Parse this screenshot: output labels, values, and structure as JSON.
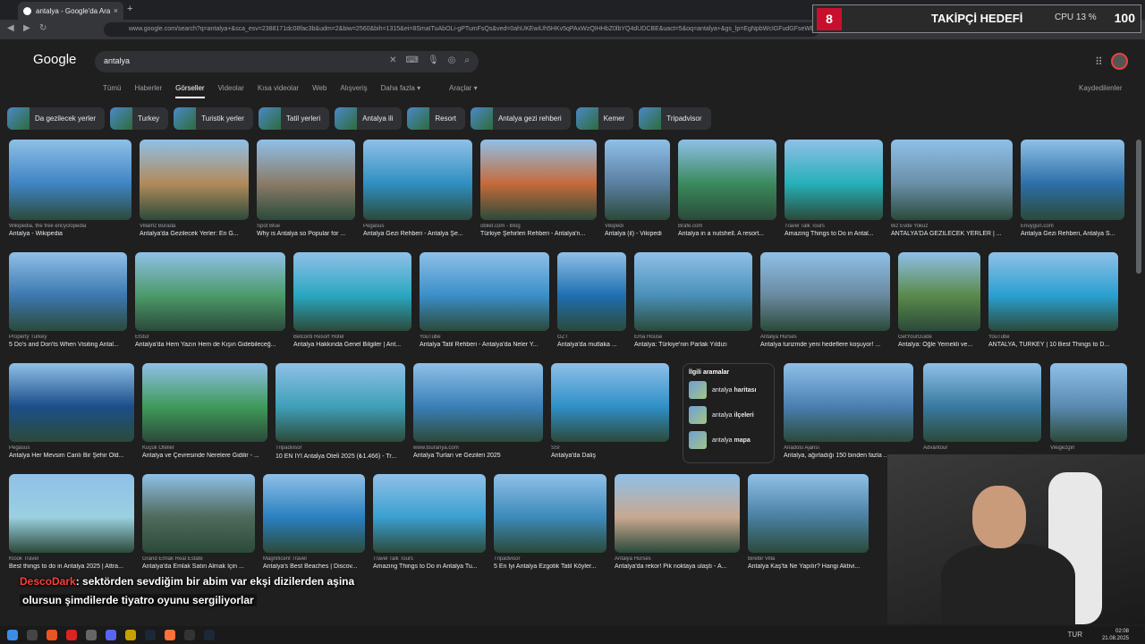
{
  "browser": {
    "tab_title": "antalya - Google'da Ara",
    "tab_close": "×",
    "new_tab": "+",
    "url": "www.google.com/search?q=antalya+&sca_esv=2388171dc08fac3b&udm=2&biw=2560&bih=1315&ei=8SmaITuAbOLi-gPTumFsQs&ved=0ahUKEwiUh5HKv5qPAxWzQIHHbZ0lbYQ4dUDCBE&uact=5&oq=antalya+&gs_lp=EgNpbWcIGFudGFseWEg"
  },
  "overlay": {
    "badge": "8",
    "text": "TAKİPÇİ HEDEFİ",
    "cpu": "CPU 13 %",
    "count": "100"
  },
  "google": {
    "logo": "Google",
    "query": "antalya",
    "tabs": [
      "Tümü",
      "Haberler",
      "Görseller",
      "Videolar",
      "Kısa videolar",
      "Web",
      "Alışveriş",
      "Daha fazla ▾"
    ],
    "active_tab": "Görseller",
    "tools": "Araçlar ▾",
    "saved": "Kaydedilenler"
  },
  "chips": [
    "Da gezilecek yerler",
    "Turkey",
    "Turistik yerler",
    "Tatil yerleri",
    "Antalya ili",
    "Resort",
    "Antalya gezi rehberi",
    "Kemer",
    "Tripadvisor"
  ],
  "rows": [
    [
      {
        "src": "Wikipedia, the free encyclopedia",
        "cap": "Antalya - Wikipedia",
        "color": "#3f84c4"
      },
      {
        "src": "Villamz Burada",
        "cap": "Antalya'da Gezilecek Yerler: En G...",
        "color": "#b08a5a"
      },
      {
        "src": "Spot Blue",
        "cap": "Why is Antalya so Popular for ...",
        "color": "#8a7b68"
      },
      {
        "src": "Pegasus",
        "cap": "Antalya Gezi Rehberi - Antalya Şe...",
        "color": "#2f8fc0"
      },
      {
        "src": "obilet.com - Blog",
        "cap": "Türkiye Şehirleri Rehberi - Antalya'n...",
        "color": "#c66a3a"
      },
      {
        "src": "Vikipedi",
        "cap": "Antalya (il) - Vikipedi",
        "color": "#5a7fa0"
      },
      {
        "src": "Brafe.com",
        "cap": "Antalya in a nutshell. A resort...",
        "color": "#3a8a5c"
      },
      {
        "src": "Travel Talk Tours",
        "cap": "Amazing Things to Do in Antal...",
        "color": "#26b0b8"
      },
      {
        "src": "Biz Evde Yokuz",
        "cap": "ANTALYA'DA GEZİLECEK YERLER | ...",
        "color": "#6a8fa8"
      },
      {
        "src": "Enuygun.com",
        "cap": "Antalya Gezi Rehberi, Antalya S...",
        "color": "#2c6fa8"
      }
    ],
    [
      {
        "src": "Property Turkey",
        "cap": "5 Do's and Don'ts When Visiting Antal...",
        "color": "#3c78b0"
      },
      {
        "src": "Etstur",
        "cap": "Antalya'da Hem Yazın Hem de Kışın Gidebileceğ...",
        "color": "#4c9a6a"
      },
      {
        "src": "Belconti Resort Hotel",
        "cap": "Antalya Hakkında Genel Bilgiler | Ant...",
        "color": "#2aa7c0"
      },
      {
        "src": "YouTube",
        "cap": "Antalya Tatil Rehberi - Antalya'da Neler Y...",
        "color": "#3a8fc8"
      },
      {
        "src": "GZT",
        "cap": "Antalya'da mutlaka ...",
        "color": "#1f6fb0"
      },
      {
        "src": "Ema House",
        "cap": "Antalya: Türkiye'nin Parlak Yıldızı",
        "color": "#4a90b8"
      },
      {
        "src": "Antalya Hürses",
        "cap": "Antalya turizmde yeni hedeflere koşuyor! ...",
        "color": "#6a8aa0"
      },
      {
        "src": "GetYourGuide",
        "cap": "Antalya: Öğle Yemekli ve...",
        "color": "#5a8a4a"
      },
      {
        "src": "YouTube",
        "cap": "ANTALYA, TURKEY | 10 Best Things to D...",
        "color": "#2aa0d0"
      }
    ],
    [
      {
        "src": "Pegasus",
        "cap": "Antalya Her Mevsim Canlı Bir Şehir Old...",
        "color": "#1c4f8a"
      },
      {
        "src": "Küçük Oteller",
        "cap": "Antalya ve Çevresinde Nerelere Gidilir - ...",
        "color": "#3f9a5a"
      },
      {
        "src": "Tripadvisor",
        "cap": "10 EN İYİ Antalya Oteli 2025 (₺1.466) - Tr...",
        "color": "#3fa0b8"
      },
      {
        "src": "www.touranya.com",
        "cap": "Antalya Turları ve Gezileri 2025",
        "color": "#3a80b8"
      },
      {
        "src": "SSI",
        "cap": "Antalya'da Daliş",
        "color": "#2f90c8"
      },
      {
        "src": "Anadolu Ajansı",
        "cap": "Antalya, ağırladığı 150 binden fazla ...",
        "color": "#4a7fb0"
      },
      {
        "src": "Advantour",
        "cap": "",
        "color": "#3a7aa0"
      },
      {
        "src": "Vikigezgin",
        "cap": "",
        "color": "#5a8ab0"
      }
    ],
    [
      {
        "src": "Klook Travel",
        "cap": "Best things to do in Antalya 2025 | Attra...",
        "color": "#9ad0e0"
      },
      {
        "src": "Grand Emlak Real Estate",
        "cap": "Antalya'da Emlak Satın Almak İçin ...",
        "color": "#4f6a5a"
      },
      {
        "src": "Magnificent Travel",
        "cap": "Antalya's Best Beaches | Discov...",
        "color": "#2a80c0"
      },
      {
        "src": "Travel Talk Tours",
        "cap": "Amazing Things to Do in Antalya Tu...",
        "color": "#3aa0d0"
      },
      {
        "src": "Tripadvisor",
        "cap": "5 En İyi Antalya Ezgotik Tatil Köyler...",
        "color": "#3c8ab8"
      },
      {
        "src": "Antalya Hürses",
        "cap": "Antalya'da rekor! Pik noktaya ulaştı - A...",
        "color": "#c8a890"
      },
      {
        "src": "Birebir Villa",
        "cap": "Antalya Kaş'ta Ne Yapılır? Hangi Aktivi...",
        "color": "#4a7fa0"
      }
    ]
  ],
  "related": {
    "title": "İlgili aramalar",
    "items": [
      {
        "pre": "antalya",
        "bold": "haritası"
      },
      {
        "pre": "antalya",
        "bold": "ilçeleri"
      },
      {
        "pre": "antalya",
        "bold": "mapa"
      }
    ]
  },
  "chat": {
    "user": "DescoDark",
    "line1": ": sektörden sevdiğim bir abim var ekşi dizilerden aşina",
    "line2": "olursun şimdilerde tiyatro oyunu sergiliyorlar"
  },
  "taskbar": {
    "time": "02:08",
    "date": "21.08.2025",
    "lang": "TUR"
  }
}
